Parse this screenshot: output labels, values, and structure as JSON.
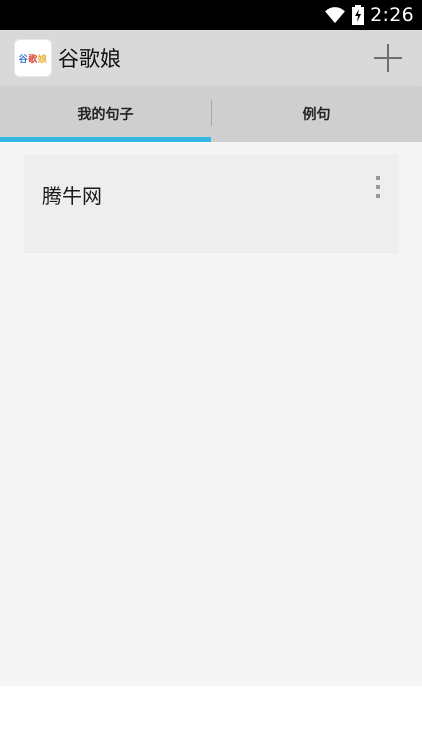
{
  "status_bar": {
    "time": "2:26",
    "icons": [
      "wifi-icon",
      "battery-charging-icon"
    ]
  },
  "action_bar": {
    "logo_text": [
      "谷",
      "歌",
      "娘"
    ],
    "title": "谷歌娘",
    "add_icon": "plus-icon"
  },
  "tabs": [
    {
      "label": "我的句子",
      "selected": true
    },
    {
      "label": "例句",
      "selected": false
    }
  ],
  "colors": {
    "accent": "#33b5e5",
    "action_bar_bg": "#d9d9d9",
    "tab_bg": "#cfcfcf",
    "content_bg": "#f5f5f5",
    "card_bg": "#eeeeee"
  },
  "cards": [
    {
      "title": "腾牛网",
      "menu_icon": "overflow-menu-icon"
    }
  ]
}
